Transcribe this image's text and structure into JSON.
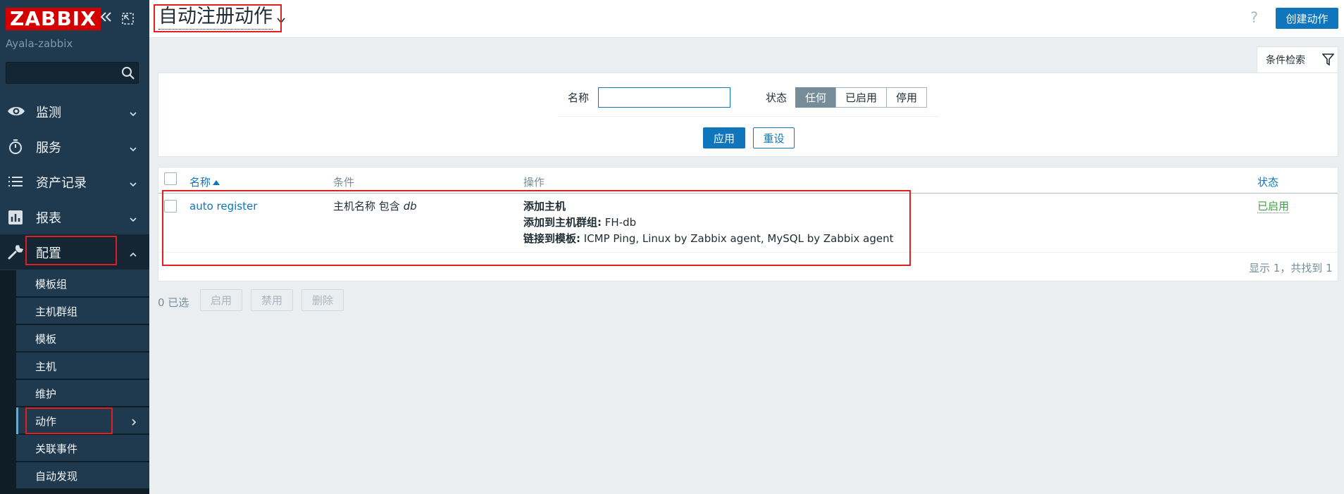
{
  "sidebar": {
    "logo": "ZABBIX",
    "server_name": "Ayala-zabbix",
    "search_value": "",
    "menu": [
      {
        "label": "监测",
        "icon": "eye-icon"
      },
      {
        "label": "服务",
        "icon": "stopwatch-icon"
      },
      {
        "label": "资产记录",
        "icon": "list-icon"
      },
      {
        "label": "报表",
        "icon": "bar-chart-icon"
      },
      {
        "label": "配置",
        "icon": "wrench-icon"
      }
    ],
    "submenu": [
      {
        "label": "模板组"
      },
      {
        "label": "主机群组"
      },
      {
        "label": "模板"
      },
      {
        "label": "主机"
      },
      {
        "label": "维护"
      },
      {
        "label": "动作"
      },
      {
        "label": "关联事件"
      },
      {
        "label": "自动发现"
      }
    ]
  },
  "header": {
    "title": "自动注册动作",
    "help": "?",
    "create_button": "创建动作"
  },
  "filter": {
    "tab_label": "条件检索",
    "name_label": "名称",
    "name_value": "",
    "status_label": "状态",
    "status_options": [
      "任何",
      "已启用",
      "停用"
    ],
    "status_selected": "任何",
    "apply": "应用",
    "reset": "重设"
  },
  "table": {
    "columns": {
      "name": "名称",
      "conditions": "条件",
      "operations": "操作",
      "status": "状态"
    },
    "rows": [
      {
        "name": "auto register",
        "condition_prefix": "主机名称 包含",
        "condition_value": "db",
        "op1_label": "添加主机",
        "op2_label": "添加到主机群组:",
        "op2_value": "FH-db",
        "op3_label": "链接到模板:",
        "op3_value": "ICMP Ping, Linux by Zabbix agent, MySQL by Zabbix agent",
        "status": "已启用"
      }
    ],
    "paging": "显示 1，共找到 1"
  },
  "footer": {
    "selected_count": "0 已选",
    "enable": "启用",
    "disable": "禁用",
    "delete": "删除"
  },
  "colors": {
    "sidebar_bg": "#1f3a4f",
    "accent": "#0f75bc",
    "status_enabled": "#429e47",
    "highlight_box": "#e02020"
  }
}
